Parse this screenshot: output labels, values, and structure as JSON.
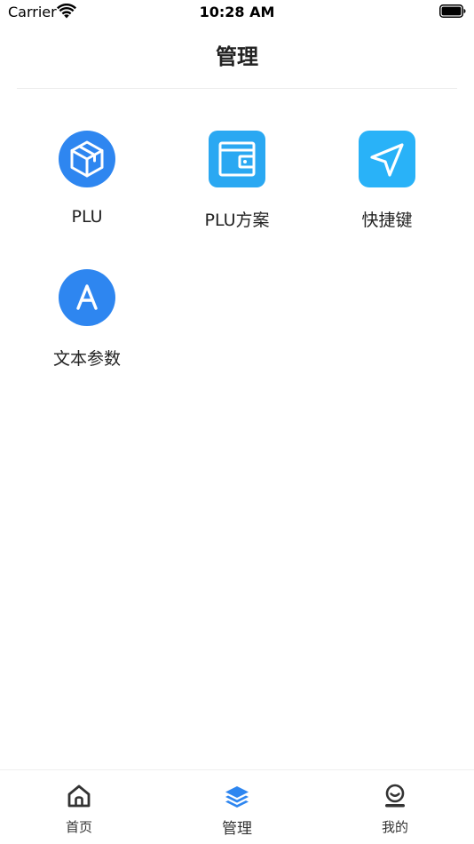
{
  "status_bar": {
    "carrier": "Carrier",
    "time": "10:28 AM",
    "wifi_icon": "wifi-icon",
    "battery_icon": "battery-icon"
  },
  "nav": {
    "title": "管理"
  },
  "menu": {
    "items": [
      {
        "label": "PLU",
        "icon": "cube-icon",
        "color": "#2e86f0"
      },
      {
        "label": "PLU方案",
        "icon": "wallet-icon",
        "color": "#2aa8f2"
      },
      {
        "label": "快捷键",
        "icon": "send-icon",
        "color": "#29b2f8"
      },
      {
        "label": "文本参数",
        "icon": "letter-a-icon",
        "color": "#2e86f0"
      }
    ]
  },
  "tabbar": {
    "active_color": "#2e86f0",
    "items": [
      {
        "label": "首页",
        "icon": "home-icon"
      },
      {
        "label": "管理",
        "icon": "layers-icon"
      },
      {
        "label": "我的",
        "icon": "profile-icon"
      }
    ]
  }
}
